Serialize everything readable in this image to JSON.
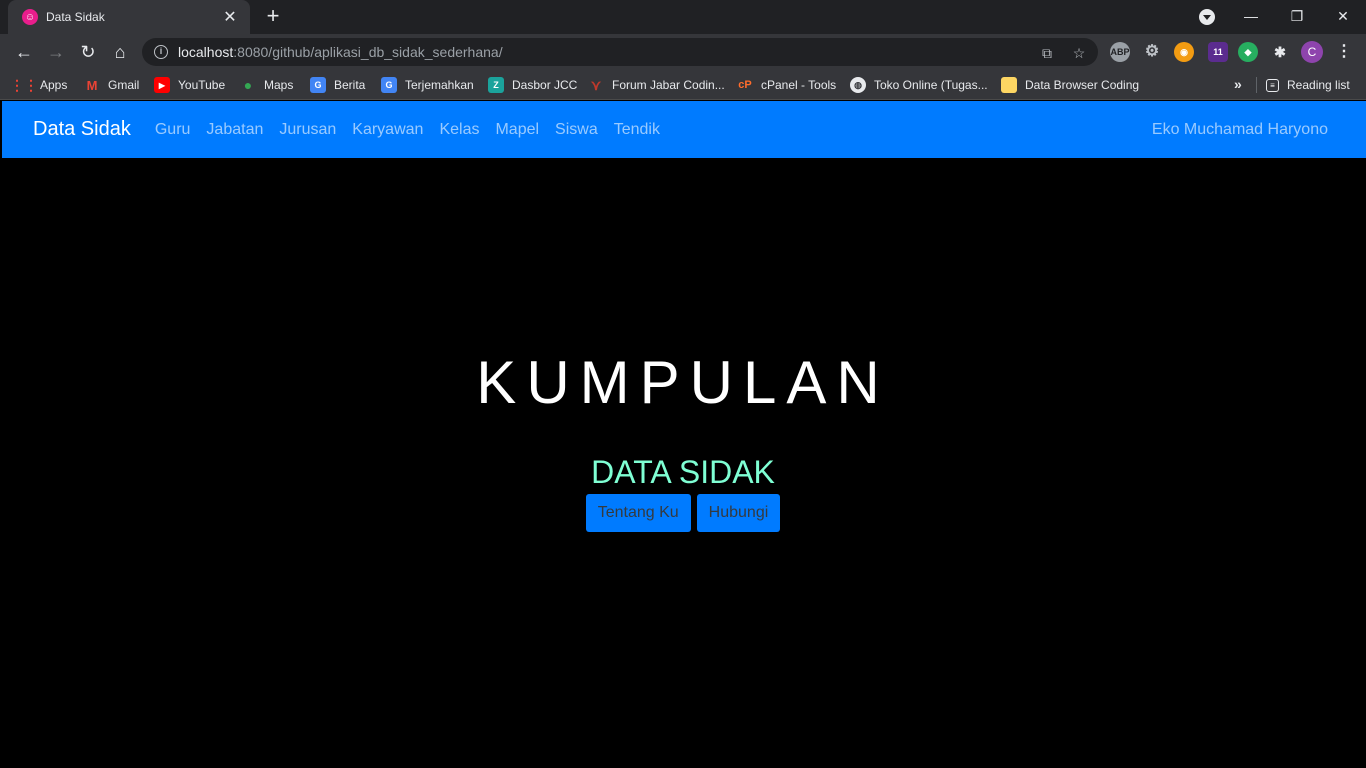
{
  "browser": {
    "tab": {
      "title": "Data Sidak"
    },
    "url": {
      "host": "localhost",
      "rest": ":8080/github/aplikasi_db_sidak_sederhana/"
    },
    "bookmarks": [
      {
        "label": "Apps",
        "icon": "apps-grid-icon",
        "color": "#ea4335"
      },
      {
        "label": "Gmail",
        "icon": "gmail-icon",
        "color": "#ea4335"
      },
      {
        "label": "YouTube",
        "icon": "youtube-icon",
        "color": "#ff0000"
      },
      {
        "label": "Maps",
        "icon": "maps-pin-icon",
        "color": "#34a853"
      },
      {
        "label": "Berita",
        "icon": "news-icon",
        "color": "#4285f4"
      },
      {
        "label": "Terjemahkan",
        "icon": "translate-icon",
        "color": "#4285f4"
      },
      {
        "label": "Dasbor JCC",
        "icon": "jcc-icon",
        "color": "#1ba39c"
      },
      {
        "label": "Forum Jabar Codin...",
        "icon": "forum-icon",
        "color": "#c0392b"
      },
      {
        "label": "cPanel - Tools",
        "icon": "cpanel-icon",
        "color": "#ff6c2c"
      },
      {
        "label": "Toko Online (Tugas...",
        "icon": "globe-icon",
        "color": "#e8eaed"
      },
      {
        "label": "Data Browser Coding",
        "icon": "folder-icon",
        "color": "#fdd663"
      }
    ],
    "more_label": "»",
    "reading_list": "Reading list",
    "extensions_badge": "11",
    "profile_initial": "C"
  },
  "navbar": {
    "brand": "Data Sidak",
    "links": [
      "Guru",
      "Jabatan",
      "Jurusan",
      "Karyawan",
      "Kelas",
      "Mapel",
      "Siswa",
      "Tendik"
    ],
    "user": "Eko Muchamad Haryono"
  },
  "hero": {
    "title": "KUMPULAN",
    "subtitle": "DATA SIDAK",
    "buttons": [
      "Tentang Ku",
      "Hubungi"
    ]
  },
  "colors": {
    "navbar_bg": "#007bff",
    "page_bg": "#000000",
    "subtitle": "#7fffd4"
  }
}
